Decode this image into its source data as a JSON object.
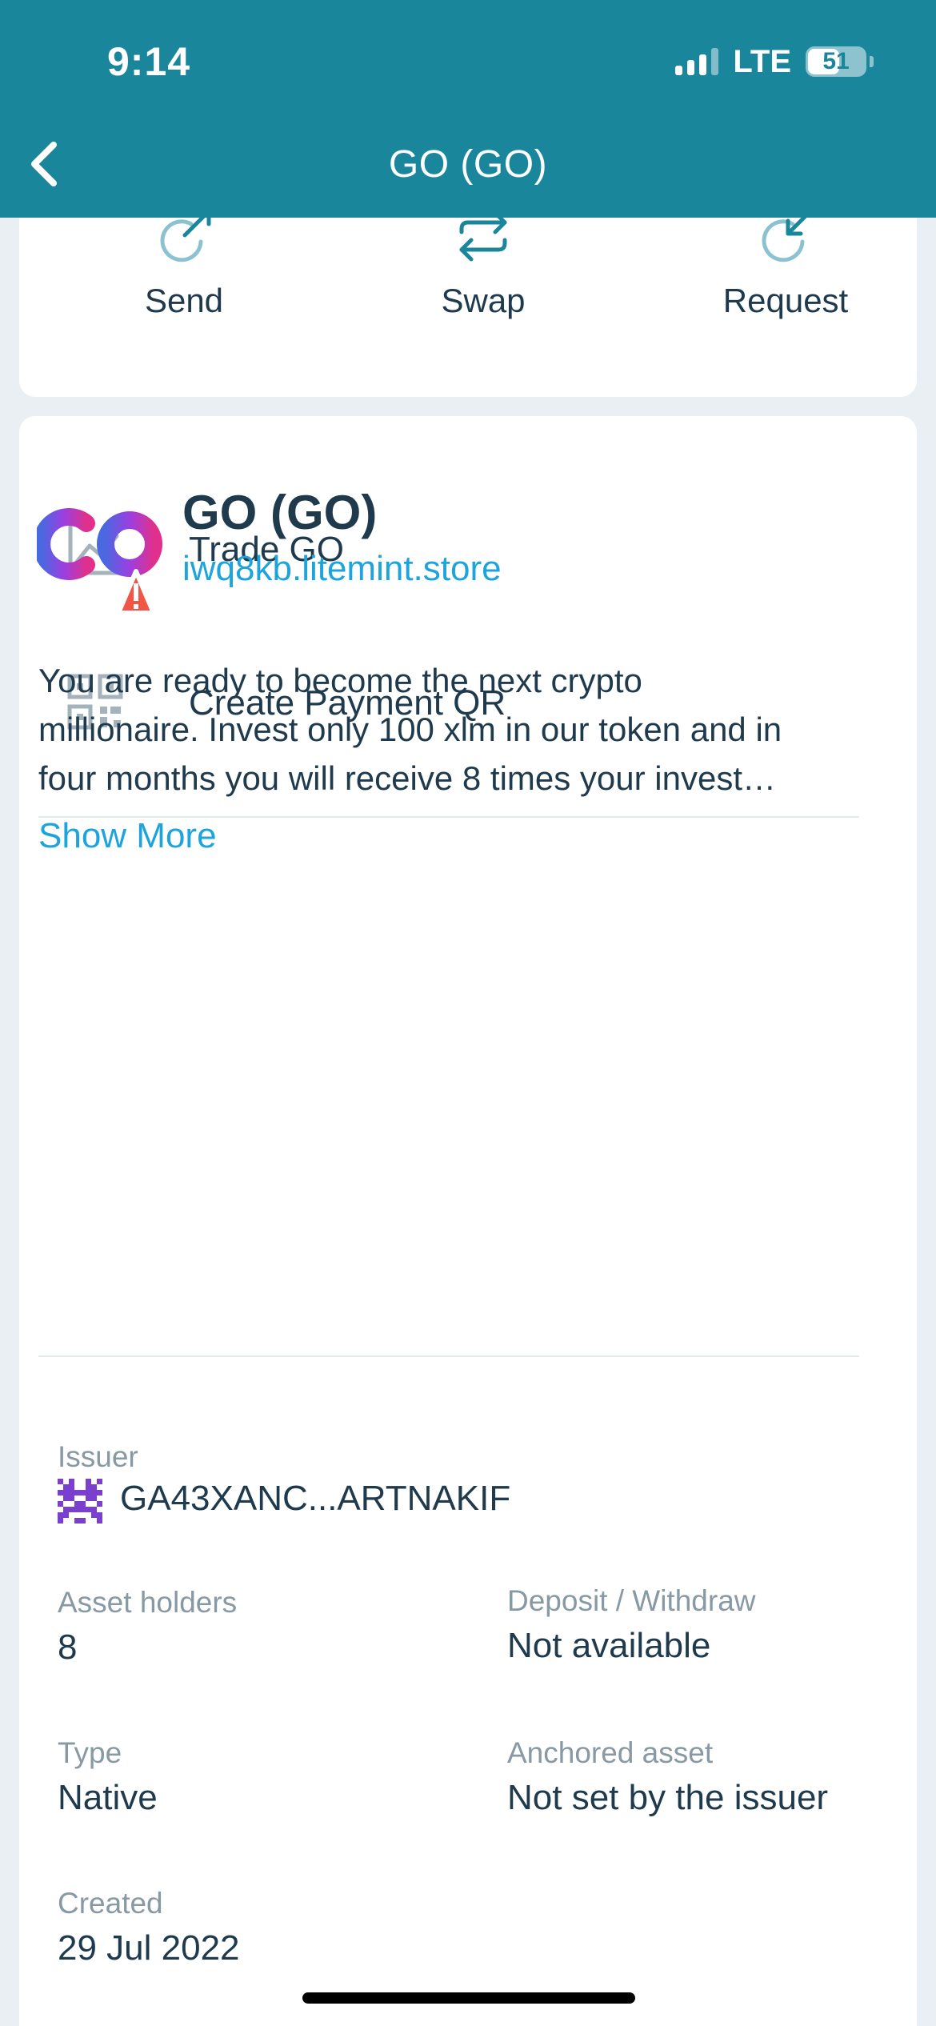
{
  "status_bar": {
    "time": "9:14",
    "network": "LTE",
    "battery": "51"
  },
  "nav": {
    "title": "GO (GO)"
  },
  "actions": [
    {
      "label": "Send",
      "icon": "send-icon"
    },
    {
      "label": "Swap",
      "icon": "swap-icon"
    },
    {
      "label": "Request",
      "icon": "request-icon"
    }
  ],
  "menu": [
    {
      "label": "Trade GO",
      "icon": "chart-icon"
    },
    {
      "label": "Create Payment QR",
      "icon": "qr-code-icon"
    }
  ],
  "asset": {
    "name": "GO (GO)",
    "domain": "iwq8kb.litemint.store",
    "description_lines": [
      "You are ready to become the next crypto",
      "millionaire. Invest only 100 xlm in our token and in",
      "four months you will receive 8 times your invest…"
    ],
    "show_more": "Show More",
    "logo_text": "GO"
  },
  "details": {
    "issuer_label": "Issuer",
    "issuer_value": "GA43XANC...ARTNAKIF",
    "holders_label": "Asset holders",
    "holders_value": "8",
    "deposit_label": "Deposit / Withdraw",
    "deposit_value": "Not available",
    "type_label": "Type",
    "type_value": "Native",
    "anchored_label": "Anchored asset",
    "anchored_value": "Not set by the issuer",
    "created_label": "Created",
    "created_value": "29 Jul 2022"
  },
  "colors": {
    "header": "#1a869c",
    "link": "#1ea4dc",
    "text": "#1f3a4d",
    "warning": "#f05545"
  }
}
